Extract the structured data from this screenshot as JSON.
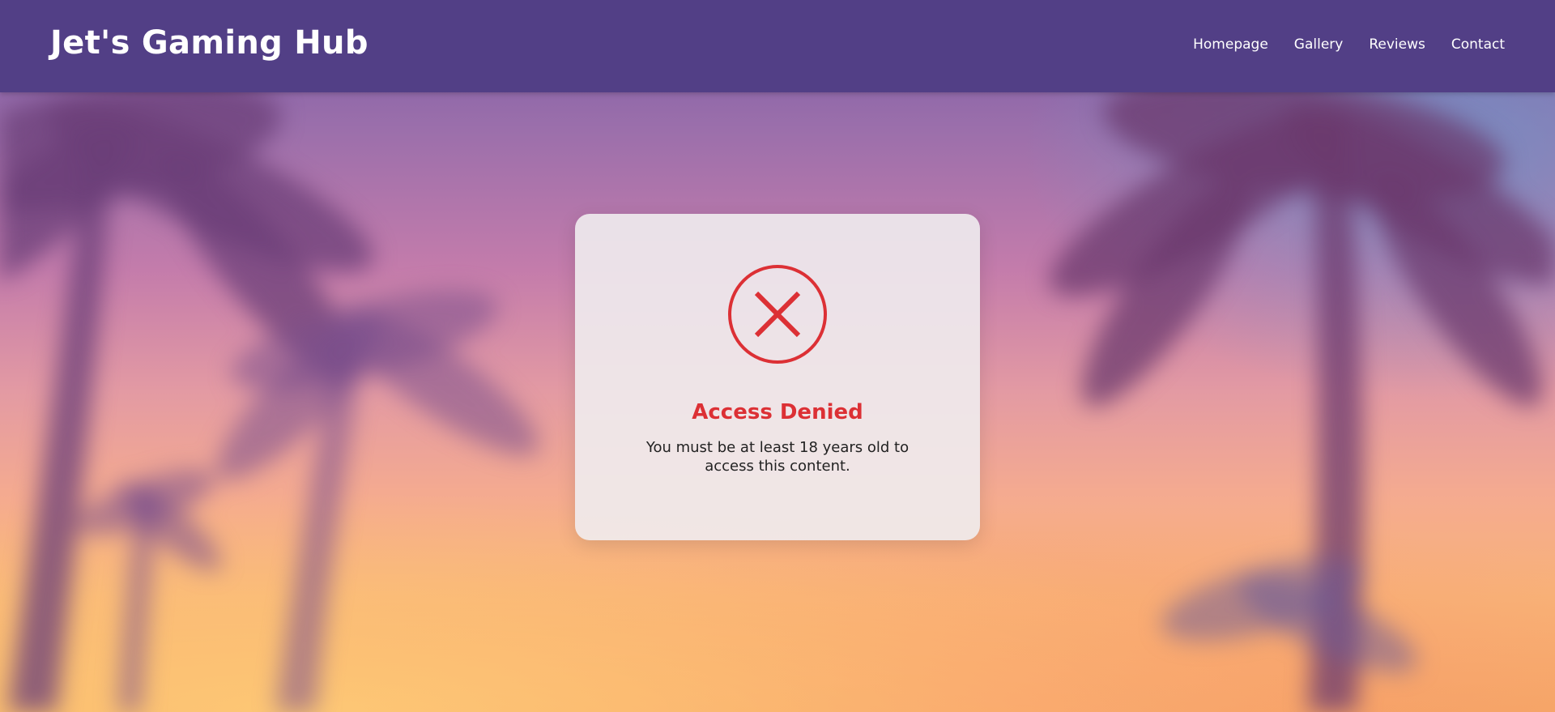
{
  "site": {
    "title": "Jet's Gaming Hub"
  },
  "nav": {
    "items": [
      {
        "label": "Homepage"
      },
      {
        "label": "Gallery"
      },
      {
        "label": "Reviews"
      },
      {
        "label": "Contact"
      }
    ]
  },
  "modal": {
    "icon": "error-x-circle-icon",
    "title": "Access Denied",
    "message": "You must be at least 18 years old to access this content."
  },
  "colors": {
    "navbar": "#523f86",
    "error_red": "#dc3035",
    "modal_background": "#f0ecee"
  }
}
